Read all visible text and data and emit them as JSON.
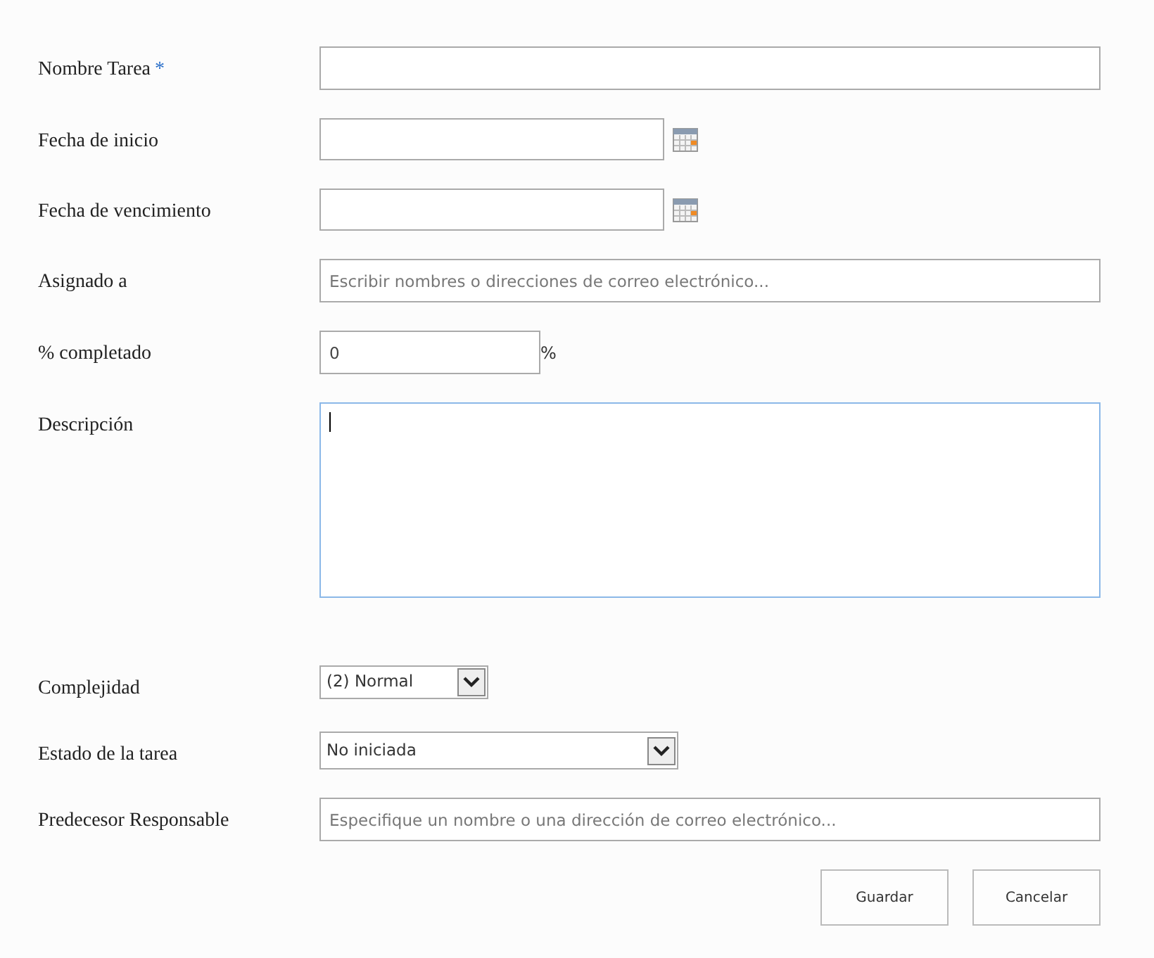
{
  "fields": [
    {
      "kind": "text",
      "label": "Nombre Tarea",
      "required_mark": "*"
    },
    {
      "kind": "date",
      "label": "Fecha de inicio"
    },
    {
      "kind": "date",
      "label": "Fecha de vencimiento"
    },
    {
      "kind": "people",
      "label": "Asignado a",
      "placeholder": "Escribir nombres o direcciones de correo electrónico..."
    },
    {
      "kind": "percent",
      "label": "% completado",
      "value": "0",
      "suffix": "%"
    },
    {
      "kind": "textarea",
      "label": "Descripción",
      "focused": true
    },
    {
      "kind": "select",
      "label": "Complejidad",
      "value": "(2) Normal"
    },
    {
      "kind": "select",
      "label": "Estado de la tarea",
      "value": "No iniciada"
    },
    {
      "kind": "people",
      "label": "Predecesor Responsable",
      "placeholder": "Especifique un nombre o una dirección de correo electrónico..."
    }
  ],
  "buttons": [
    "Guardar",
    "Cancelar"
  ]
}
